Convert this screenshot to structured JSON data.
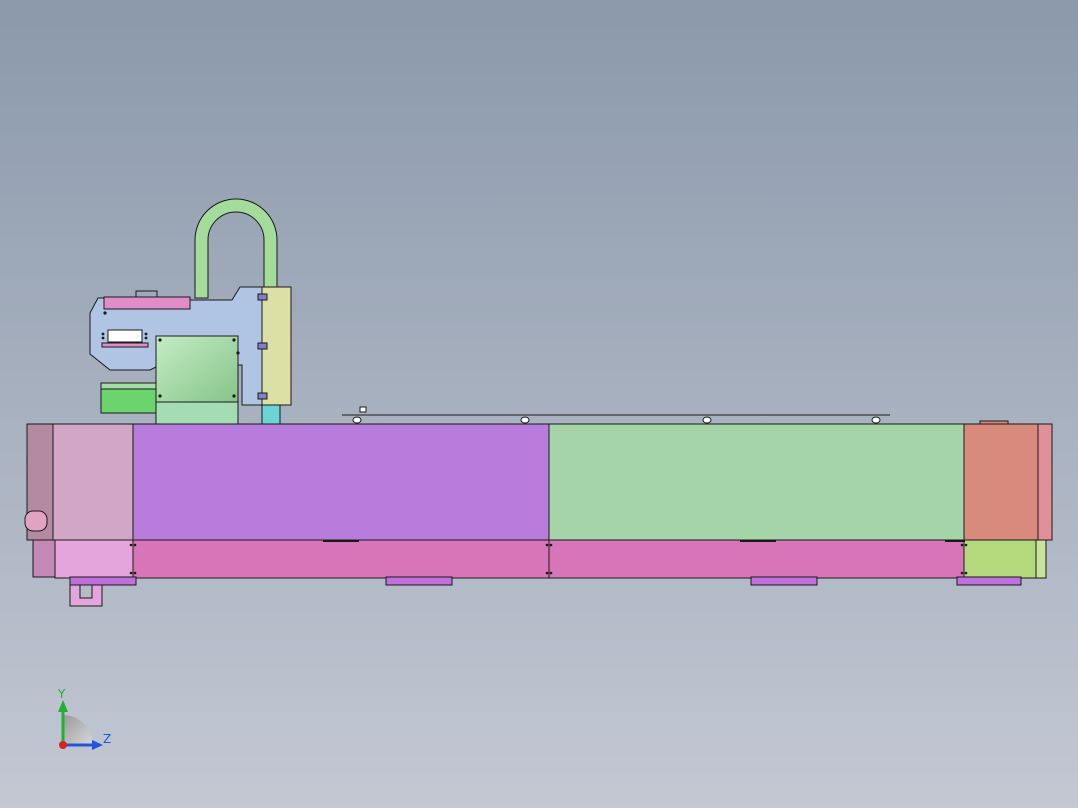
{
  "viewport": {
    "background_top": "#8b99ab",
    "background_bottom": "#c3c8d3"
  },
  "colors": {
    "outline": "#1a1a1a",
    "segment_left_end": "#b48aa0",
    "segment_left": "#d2a6c6",
    "segment_purple": "#b87cdc",
    "segment_green": "#a4d4a8",
    "segment_salmon": "#d88a7c",
    "segment_right_end": "#e0909a",
    "base_pink": "#d874b8",
    "base_light_pink": "#e4a4dc",
    "base_lime": "#b4d87c",
    "feet_purple": "#c070dc",
    "head_blue": "#b0c4e4",
    "head_pink": "#e08cc8",
    "head_green": "#a4dca8",
    "head_green_dark": "#6cd46c",
    "cable_green": "#a4dc9c",
    "panel_yellow": "#dce0a4",
    "nozzle_cyan": "#6cd4d4"
  },
  "triad": {
    "y_label": "Y",
    "z_label": "Z",
    "y_color": "#22b033",
    "z_color": "#2255dd",
    "x_color": "#dd2222"
  }
}
